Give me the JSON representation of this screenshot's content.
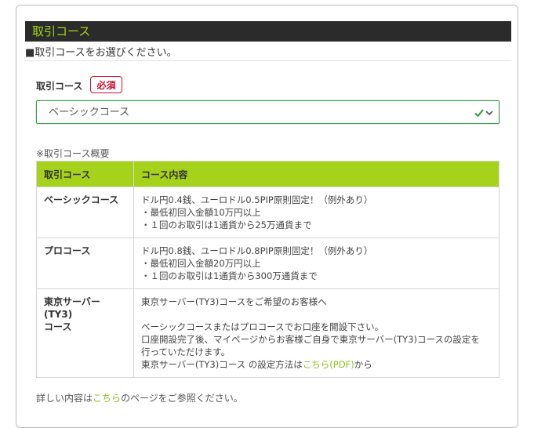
{
  "section": {
    "header": "取引コース",
    "instruction": "■取引コースをお選びください。"
  },
  "field": {
    "label": "取引コース",
    "required_badge": "必須",
    "selected_value": "ベーシックコース",
    "check_icon": "check-icon",
    "dropdown_icon": "chevron-down-icon"
  },
  "overview": {
    "label": "※取引コース概要",
    "columns": [
      "取引コース",
      "コース内容"
    ],
    "rows": [
      {
        "name": "ベーシックコース",
        "lines": [
          "ドル円0.4銭、ユーロドル0.5PIP原則固定！（例外あり）",
          "・最低初回入金額10万円以上",
          "・１回のお取引は1通貨から25万通貨まで"
        ]
      },
      {
        "name": "プロコース",
        "lines": [
          "ドル円0.8銭、ユーロドル0.8PIP原則固定！（例外あり）",
          "・最低初回入金額20万円以上",
          "・１回のお取引は1通貨から300万通貨まで"
        ]
      },
      {
        "name_line1": "東京サーバー(TY3)",
        "name_line2": "コース",
        "line1": "東京サーバー(TY3)コースをご希望のお客様へ",
        "line2": "ベーシックコースまたはプロコースでお口座を開設下さい。",
        "line3": "口座開設完了後、マイページからお客様ご自身で東京サーバー(TY3)コースの設定を",
        "line4": "行っていただけます。",
        "line5_prefix": "東京サーバー(TY3)コース の設定方法は",
        "line5_link": "こちら(PDF)",
        "line5_suffix": "から"
      }
    ]
  },
  "footer": {
    "prefix": "詳しい内容は",
    "link": "こちら",
    "suffix": "のページをご参照ください。"
  },
  "colors": {
    "header_bg": "#2b2b2b",
    "header_text": "#a6d610",
    "table_header_bg": "#a6d21c",
    "required": "#c8102e",
    "select_border": "#3aa14b",
    "link": "#8cc21b"
  }
}
